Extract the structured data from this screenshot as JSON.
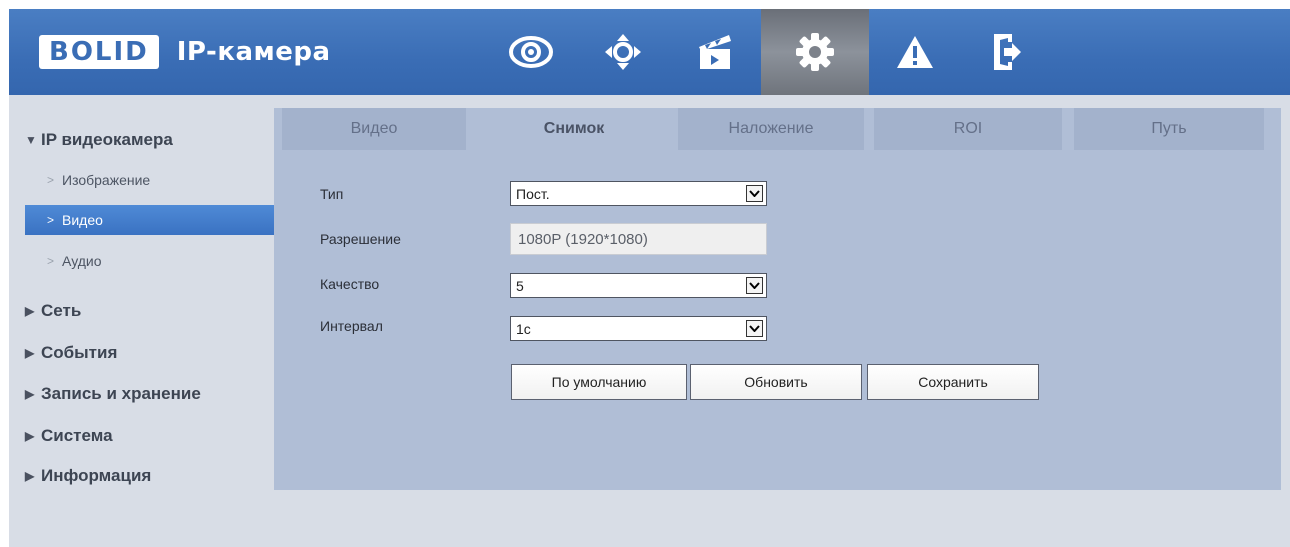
{
  "header": {
    "logo_text": "BOLID",
    "title": "IP-камера",
    "nav": [
      {
        "icon": "eye-icon"
      },
      {
        "icon": "ptz-icon"
      },
      {
        "icon": "clapperboard-icon"
      },
      {
        "icon": "gear-icon"
      },
      {
        "icon": "warning-icon"
      },
      {
        "icon": "logout-icon"
      }
    ]
  },
  "sidebar": {
    "section": "IP видеокамера",
    "subitems": [
      "Изображение",
      "Видео",
      "Аудио"
    ],
    "active_subitem": "Видео",
    "groups": [
      "Сеть",
      "События",
      "Запись и хранение",
      "Система",
      "Информация"
    ]
  },
  "tabs": [
    "Видео",
    "Снимок",
    "Наложение",
    "ROI",
    "Путь"
  ],
  "active_tab": "Снимок",
  "form": {
    "type_label": "Тип",
    "type_value": "Пост.",
    "resolution_label": "Разрешение",
    "resolution_value": "1080P (1920*1080)",
    "quality_label": "Качество",
    "quality_value": "5",
    "interval_label": "Интервал",
    "interval_value": "1c"
  },
  "buttons": {
    "default": "По умолчанию",
    "refresh": "Обновить",
    "save": "Сохранить"
  },
  "colors": {
    "header_blue": "#3a6db5",
    "active_blue": "#3a72c2",
    "panel": "#b0bed6"
  }
}
